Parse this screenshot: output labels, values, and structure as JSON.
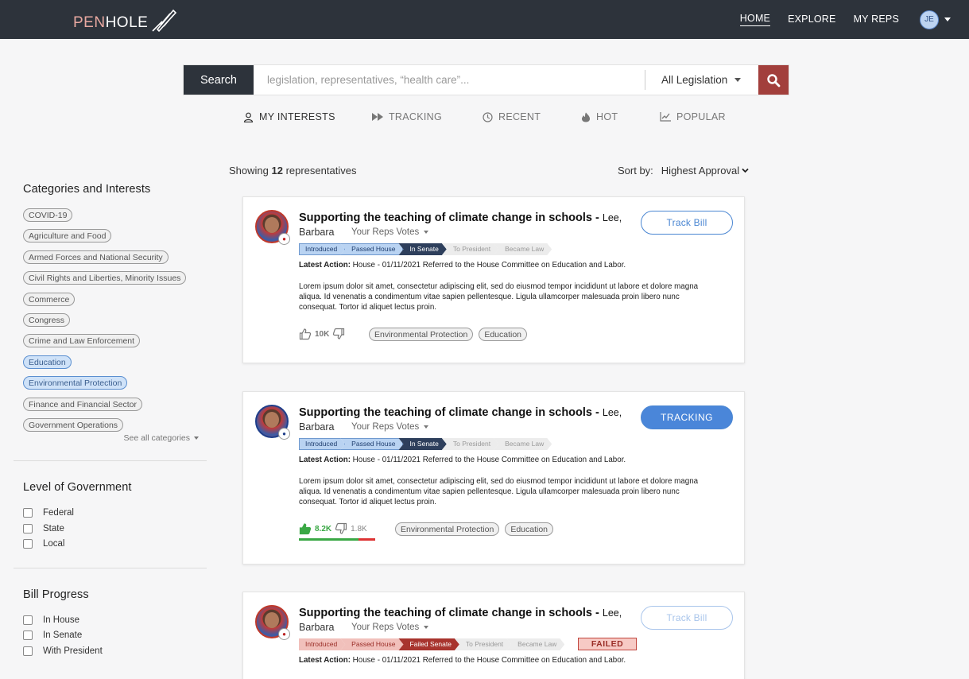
{
  "brand": {
    "logo_pen": "PEN",
    "logo_hole": "HOLE"
  },
  "nav": {
    "home": "HOME",
    "explore": "EXPLORE",
    "my_reps": "MY REPS",
    "avatar_initials": "JE"
  },
  "search": {
    "button": "Search",
    "placeholder": "legislation, representatives, “health care”...",
    "scope": "All Legislation"
  },
  "tabs": {
    "my_interests": "MY INTERESTS",
    "tracking": "TRACKING",
    "recent": "RECENT",
    "hot": "HOT",
    "popular": "POPULAR"
  },
  "results": {
    "prefix": "Showing ",
    "count": "12",
    "suffix": " representatives",
    "sort_label": "Sort by:",
    "sort_value": "Highest Approval"
  },
  "sidebar": {
    "categories_title": "Categories and Interests",
    "categories": [
      {
        "label": "COVID-19",
        "selected": false
      },
      {
        "label": "Agriculture and Food",
        "selected": false
      },
      {
        "label": "Armed Forces and National Security",
        "selected": false
      },
      {
        "label": "Civil Rights and Liberties, Minority Issues",
        "selected": false
      },
      {
        "label": "Commerce",
        "selected": false
      },
      {
        "label": "Congress",
        "selected": false
      },
      {
        "label": "Crime and Law Enforcement",
        "selected": false
      },
      {
        "label": "Education",
        "selected": true
      },
      {
        "label": "Environmental Protection",
        "selected": true
      },
      {
        "label": "Finance and Financial Sector",
        "selected": false
      },
      {
        "label": "Government Operations",
        "selected": false
      }
    ],
    "see_all": "See all categories",
    "government_title": "Level of Government",
    "government": [
      "Federal",
      "State",
      "Local"
    ],
    "progress_title": "Bill Progress",
    "progress": [
      "In House",
      "In Senate",
      "With President"
    ]
  },
  "cards": [
    {
      "title": "Supporting the teaching of climate change in schools - ",
      "author_first": "Lee,",
      "author_last": "Barbara",
      "rep_votes": "Your Reps Votes",
      "steps": [
        "Introduced",
        "Passed House",
        "In Senate",
        "To President",
        "Became Law"
      ],
      "latest_label": "Latest Action:",
      "latest": " House - 01/11/2021 Referred to the House Committee on Education and Labor.",
      "body": "Lorem ipsum dolor sit amet, consectetur adipiscing elit, sed do eiusmod tempor incididunt ut labore et dolore magna aliqua. Id venenatis a condimentum vitae sapien pellentesque. Ligula ullamcorper malesuada proin libero nunc consequat. Tortor id aliquet lectus proin.",
      "upvotes": "10K",
      "tags": [
        "Environmental Protection",
        "Education"
      ],
      "button": "Track Bill"
    },
    {
      "title": "Supporting the teaching of climate change in schools - ",
      "author_first": "Lee,",
      "author_last": "Barbara",
      "rep_votes": "Your Reps Votes",
      "steps": [
        "Introduced",
        "Passed House",
        "In Senate",
        "To President",
        "Became Law"
      ],
      "latest_label": "Latest Action:",
      "latest": " House - 01/11/2021 Referred to the House Committee on Education and Labor.",
      "body": "Lorem ipsum dolor sit amet, consectetur adipiscing elit, sed do eiusmod tempor incididunt ut labore et dolore magna aliqua. Id venenatis a condimentum vitae sapien pellentesque. Ligula ullamcorper malesuada proin libero nunc consequat. Tortor id aliquet lectus proin.",
      "upvotes": "8.2K",
      "downvotes": "1.8K",
      "approval_fraction": 0.78,
      "tags": [
        "Environmental Protection",
        "Education"
      ],
      "button": "TRACKING"
    },
    {
      "title": "Supporting the teaching of climate change in schools - ",
      "author_first": "Lee,",
      "author_last": "Barbara",
      "rep_votes": "Your Reps Votes",
      "steps": [
        "Introduced",
        "Passed House",
        "Failed Senate",
        "To President",
        "Became Law"
      ],
      "status": "FAILED",
      "latest_label": "Latest Action:",
      "latest": " House - 01/11/2021 Referred to the House Committee on Education and Labor.",
      "button": "Track Bill"
    }
  ],
  "colors": {
    "nav_bg": "#2d333b",
    "accent_blue": "#4a86d9",
    "accent_red": "#a23f3c",
    "vote_green": "#3aa845"
  }
}
